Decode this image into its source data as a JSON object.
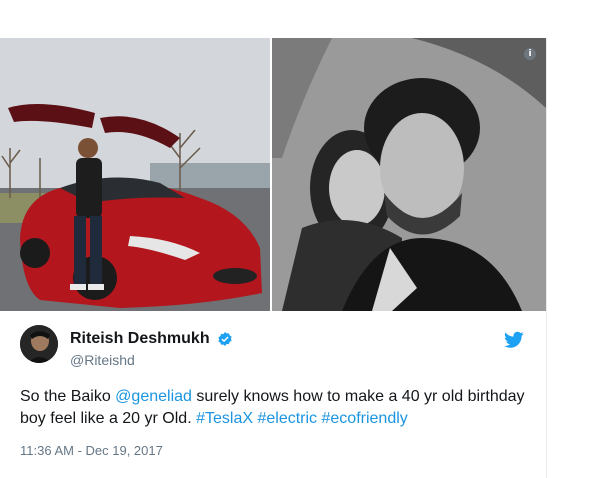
{
  "tweet": {
    "display_name": "Riteish Deshmukh",
    "handle": "@Riteishd",
    "text_part1": "So the Baiko ",
    "mention": "@geneliad",
    "text_part2": " surely knows how to make a 40 yr old birthday boy feel like a 20 yr Old. ",
    "hashtag1": "#TeslaX",
    "hashtag2": "#electric",
    "hashtag3": "#ecofriendly",
    "timestamp": "11:36 AM - Dec 19, 2017"
  },
  "media": {
    "info_icon": "i"
  },
  "colors": {
    "link": "#1b95e0",
    "text": "#14171a",
    "secondary": "#657786",
    "twitter_blue": "#1da1f2"
  },
  "icons": {
    "verified": "verified-badge-icon",
    "bird": "twitter-bird-icon",
    "info": "info-icon"
  }
}
